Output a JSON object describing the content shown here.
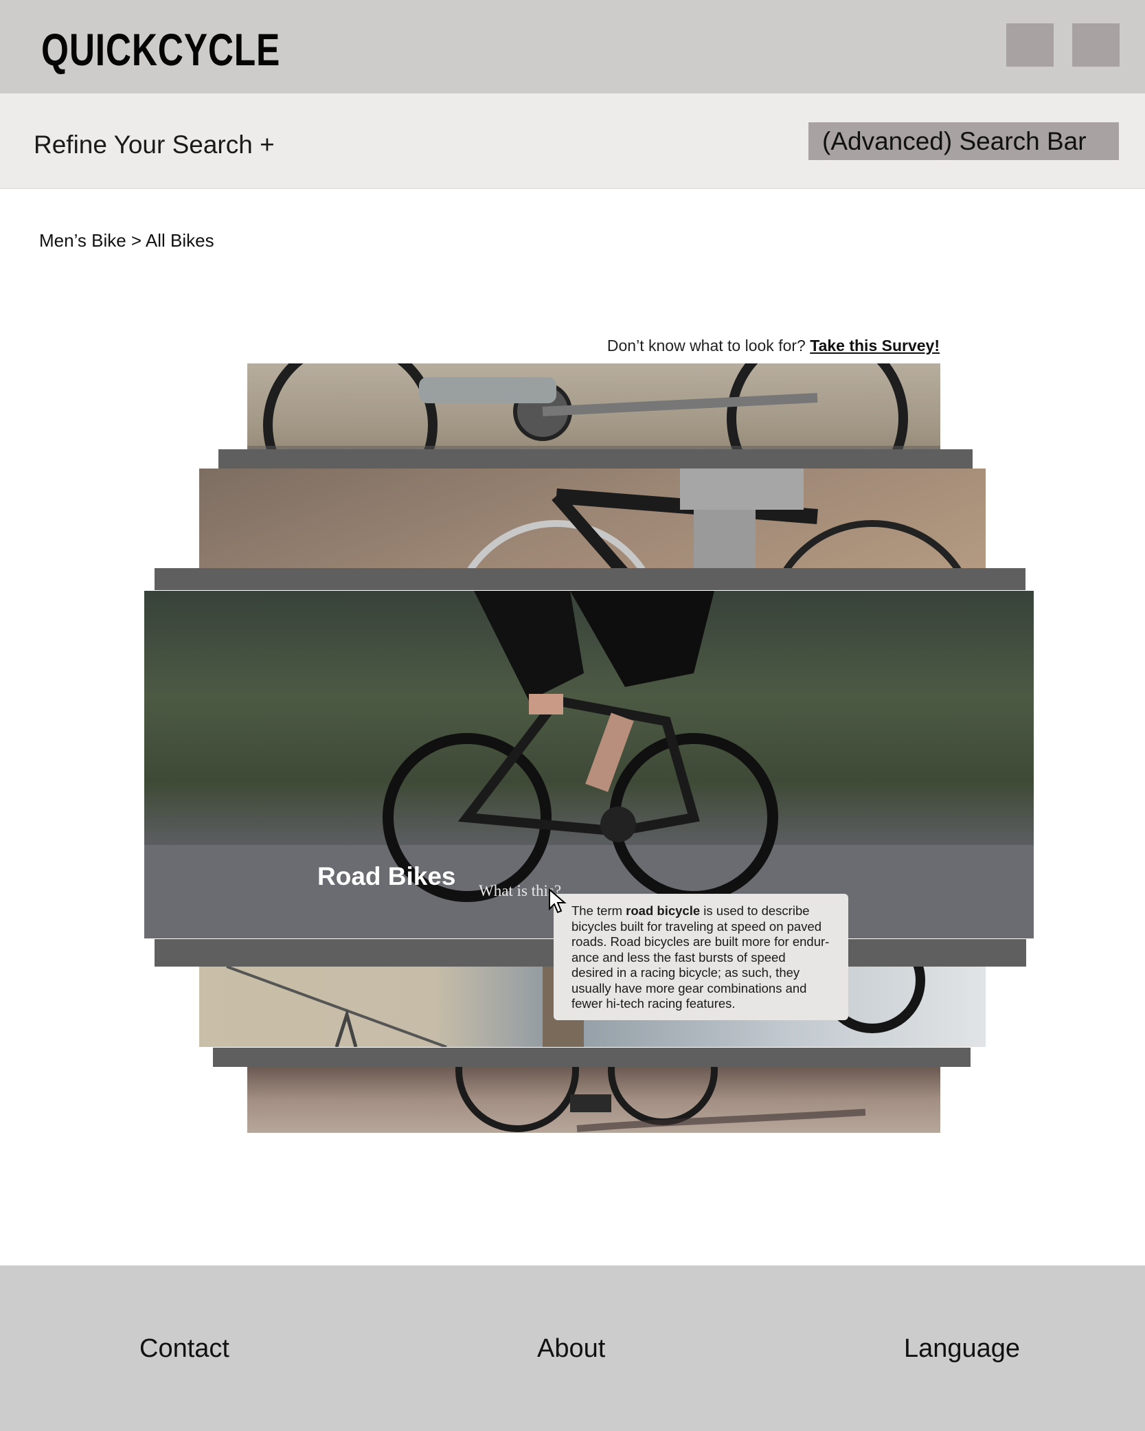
{
  "header": {
    "logo": "QUICKCYCLE",
    "buttons": [
      "header-button-1",
      "header-button-2"
    ]
  },
  "refine": {
    "label": "Refine Your Search +",
    "search_bar": "(Advanced) Search Bar"
  },
  "breadcrumb": "Men’s Bike > All Bikes",
  "survey": {
    "prompt": "Don’t know what to look for?",
    "link": "Take this Survey!"
  },
  "carousel": {
    "featured_title": "Road Bikes",
    "help_link": "What is this?",
    "tooltip": {
      "prefix": "The term ",
      "term": "road bicycle",
      "body": " is used to describe bicycles built for traveling at speed on paved roads. Road bicycles are built more for endur- ance and less the fast bursts of speed desired in a racing bicycle; as such, they usually have more gear combinations and fewer hi-tech racing features."
    }
  },
  "footer": {
    "contact": "Contact",
    "about": "About",
    "language": "Language"
  },
  "colors": {
    "header_bg": "#cecccb",
    "refine_bg": "#edecea",
    "search_bg": "#a8a3a2",
    "footer_bg": "#cccccc",
    "tooltip_bg": "#e8e6e4"
  }
}
